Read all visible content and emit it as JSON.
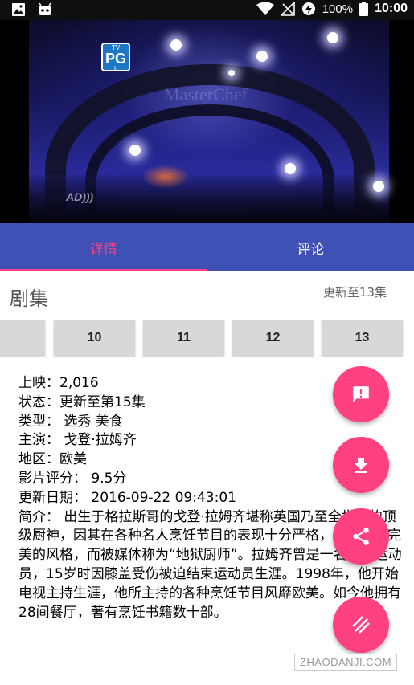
{
  "status_bar": {
    "battery": "100%",
    "time": "10:00",
    "icons": [
      "image-icon",
      "android-icon",
      "wifi-icon",
      "no-signal-icon",
      "data-saver-icon",
      "battery-icon"
    ]
  },
  "video": {
    "rating_badge": {
      "tv": "TV",
      "rating": "PG",
      "sub": "L"
    },
    "logo_text": "MasterChef",
    "ad_mark": "AD)))"
  },
  "tabs": [
    {
      "label": "详情",
      "active": true
    },
    {
      "label": "评论",
      "active": false
    }
  ],
  "episodes": {
    "title": "剧集",
    "update_text": "更新至13集",
    "items": [
      "",
      "10",
      "11",
      "12",
      "13"
    ]
  },
  "info": {
    "release": "上映：2,016",
    "status": "状态：更新至第15集",
    "type": "类型： 选秀 美食",
    "cast": "主演： 戈登·拉姆齐",
    "region": "地区：欧美",
    "rating": "影片评分： 9.5分",
    "update_date": "更新日期： 2016-09-22 09:43:01",
    "intro": "简介： 出生于格拉斯哥的戈登·拉姆齐堪称英国乃至全世界的顶级厨神，因其在各种名人烹饪节目的表现十分严格，以及追求完美的风格，而被媒体称为“地狱厨师”。拉姆齐曾是一名足球运动员，15岁时因膝盖受伤被迫结束运动员生涯。1998年，他开始电视主持生涯，他所主持的各种烹饪节目风靡欧美。如今他拥有28间餐厅，著有烹饪书籍数十部。"
  },
  "fabs": [
    {
      "icon": "feedback-icon"
    },
    {
      "icon": "download-icon"
    },
    {
      "icon": "share-icon"
    },
    {
      "icon": "menu-lines-icon"
    }
  ],
  "watermark": "ZHAODANJI.COM",
  "colors": {
    "primary": "#3f51b5",
    "accent": "#ff4081",
    "episode_button": "#d8d8d8"
  }
}
